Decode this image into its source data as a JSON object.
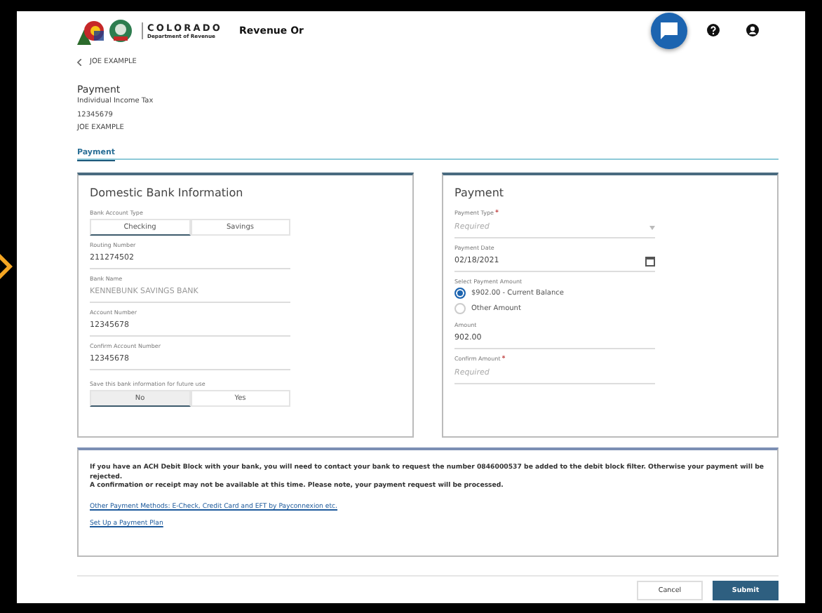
{
  "header": {
    "logo_title": "COLORADO",
    "logo_subtitle": "Department of Revenue",
    "app_title": "Revenue Or"
  },
  "back_link": "JOE EXAMPLE",
  "page": {
    "title": "Payment",
    "lines": [
      "Individual Income Tax",
      "12345679",
      "JOE EXAMPLE"
    ]
  },
  "tabs": [
    {
      "label": "Payment",
      "selected": true
    }
  ],
  "bank": {
    "title": "Domestic Bank Information",
    "account_type": {
      "label": "Bank Account Type",
      "options": [
        {
          "label": "Checking",
          "selected": true
        },
        {
          "label": "Savings",
          "selected": false
        }
      ]
    },
    "fields": [
      {
        "label": "Routing Number",
        "value": "211274502",
        "disabled": false
      },
      {
        "label": "Bank Name",
        "value": "KENNEBUNK SAVINGS BANK",
        "disabled": true
      },
      {
        "label": "Account Number",
        "value": "12345678",
        "disabled": false
      },
      {
        "label": "Confirm Account Number",
        "value": "12345678",
        "disabled": false
      }
    ],
    "save": {
      "label": "Save this bank information for future use",
      "options": [
        {
          "label": "No",
          "selected": true
        },
        {
          "label": "Yes",
          "selected": false
        }
      ]
    }
  },
  "payment": {
    "title": "Payment",
    "items": [
      {
        "kind": "select",
        "label": "Payment Type",
        "required_mark": "*",
        "placeholder": "Required"
      },
      {
        "kind": "date",
        "label": "Payment Date",
        "value": "02/18/2021"
      },
      {
        "kind": "radio",
        "label": "Select Payment Amount",
        "options": [
          {
            "label": "$902.00 - Current Balance",
            "selected": true
          },
          {
            "label": "Other Amount",
            "selected": false
          }
        ]
      },
      {
        "kind": "text",
        "label": "Amount",
        "value": "902.00"
      },
      {
        "kind": "text",
        "label": "Confirm Amount",
        "required_mark": "*",
        "placeholder": "Required"
      }
    ]
  },
  "notice": {
    "paragraphs": [
      "If you have an ACH Debit Block with your bank, you will need to contact your bank to request the number 0846000537 be added to the debit block filter. Otherwise your payment will be rejected.",
      "A confirmation or receipt may not be available at this time. Please note, your payment request will be processed."
    ],
    "links": [
      "Other Payment Methods: E-Check, Credit Card and EFT by Payconnexion etc.",
      "Set Up a Payment Plan"
    ]
  },
  "buttons": [
    {
      "label": "Cancel",
      "kind": "secondary"
    },
    {
      "label": "Submit",
      "kind": "primary"
    }
  ]
}
